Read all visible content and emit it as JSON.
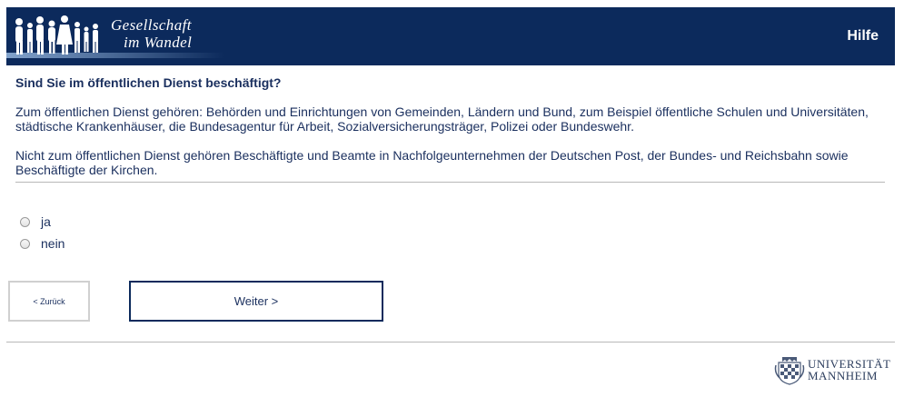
{
  "header": {
    "logo_line1": "Gesellschaft",
    "logo_line2": "im Wandel",
    "help_label": "Hilfe"
  },
  "question": {
    "title": "Sind Sie im öffentlichen Dienst beschäftigt?",
    "info1": "Zum öffentlichen Dienst gehören: Behörden und Einrichtungen von Gemeinden, Ländern und Bund, zum Beispiel öffentliche Schulen und Universitäten, städtische Krankenhäuser, die Bundesagentur für Arbeit, Sozialversicherungsträger, Polizei oder Bundeswehr.",
    "info2": "Nicht zum öffentlichen Dienst gehören Beschäftigte und Beamte in Nachfolgeunternehmen der Deutschen Post, der Bundes- und Reichsbahn sowie Beschäftigte der Kirchen."
  },
  "options": [
    {
      "label": "ja",
      "selected": false
    },
    {
      "label": "nein",
      "selected": false
    }
  ],
  "navigation": {
    "back_label": "< Zurück",
    "next_label": "Weiter >"
  },
  "footer": {
    "uni_line1": "UNIVERSITÄT",
    "uni_line2": "MANNHEIM"
  },
  "colors": {
    "header_bg": "#0c2a5c",
    "text": "#1a2f5e"
  }
}
